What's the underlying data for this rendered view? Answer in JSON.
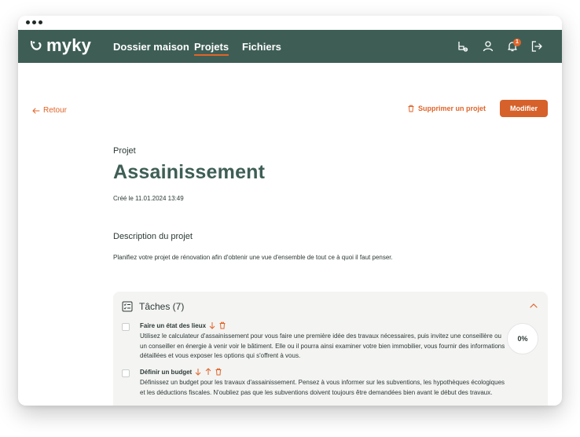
{
  "brand": {
    "name": "myky"
  },
  "nav": {
    "links": [
      "Dossier maison",
      "Projets",
      "Fichiers"
    ],
    "active": "Projets",
    "notification_count": "1"
  },
  "actions": {
    "back": "Retour",
    "delete": "Supprimer un projet",
    "modify": "Modifier"
  },
  "project": {
    "kicker": "Projet",
    "title": "Assainissement",
    "created": "Créé le 11.01.2024 13:49",
    "description_heading": "Description du projet",
    "description": "Planifiez votre projet de rénovation afin d'obtenir une vue d'ensemble de tout ce à quoi il faut penser."
  },
  "tasks": {
    "heading": "Tâches (7)",
    "progress": "0%",
    "items": [
      {
        "name": "Faire un état des lieux",
        "body": "Utilisez le calculateur d'assainissement pour vous faire une première idée des travaux nécessaires, puis invitez une conseillère ou un conseiller en énergie à venir voir le bâtiment. Elle ou il pourra ainsi examiner votre bien immobilier, vous fournir des informations détaillées et vous exposer les options qui s'offrent à vous."
      },
      {
        "name": "Définir un budget",
        "body": "Définissez un budget pour les travaux d'assainissement. Pensez à vous informer sur les subventions, les hypothèques écologiques et les déductions fiscales. N'oubliez pas que les subventions doivent toujours être demandées bien avant le début des travaux."
      }
    ]
  },
  "colors": {
    "nav_bg": "#3e5e55",
    "accent": "#e0652a",
    "title": "#3e5e55",
    "panel_bg": "#f4f4f3"
  },
  "icons": [
    "logo-mark-icon",
    "sofa-icon",
    "user-icon",
    "bell-icon",
    "logout-icon",
    "arrow-left-icon",
    "trash-icon",
    "checklist-icon",
    "chevron-up-icon",
    "arrow-down-icon",
    "arrow-up-icon"
  ]
}
